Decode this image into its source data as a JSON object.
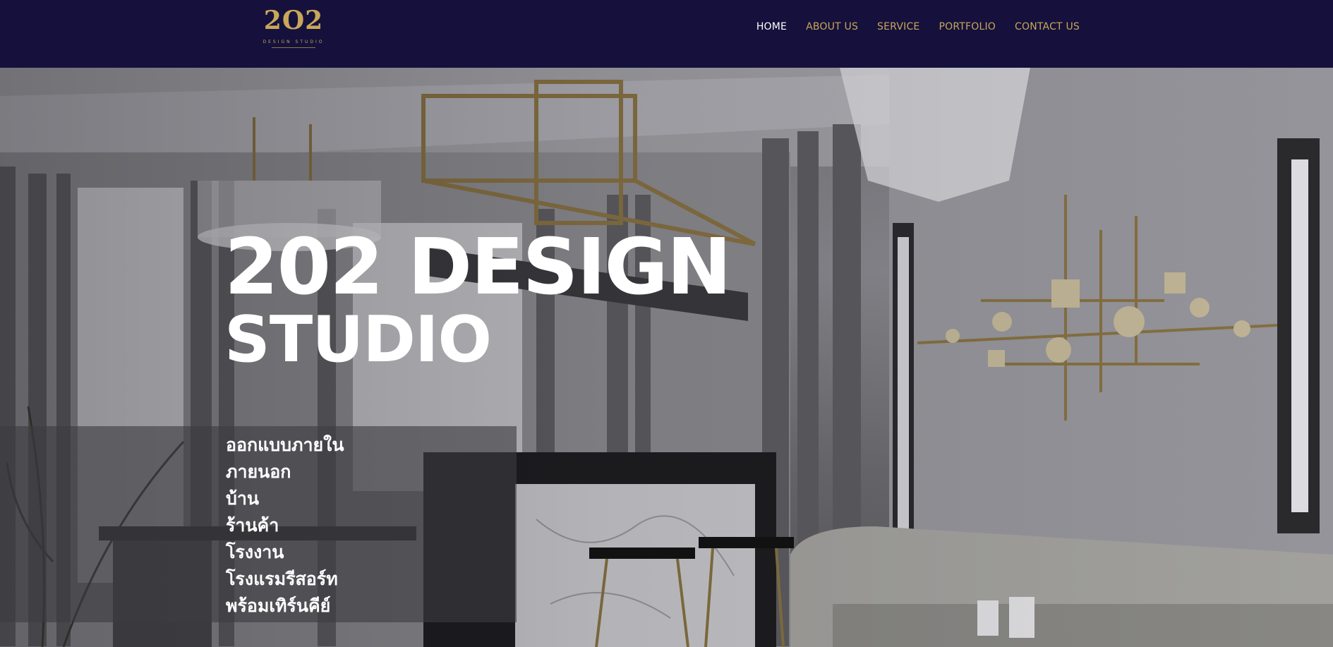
{
  "header": {
    "logo": {
      "mark": "2O2",
      "subtitle": "DESIGN STUDIO"
    },
    "nav": [
      {
        "label": "HOME",
        "active": true
      },
      {
        "label": "ABOUT US",
        "active": false
      },
      {
        "label": "SERVICE",
        "active": false
      },
      {
        "label": "PORTFOLIO",
        "active": false
      },
      {
        "label": "CONTACT US",
        "active": false
      }
    ]
  },
  "hero": {
    "title_line1": "202 DESIGN",
    "title_line2": "STUDIO",
    "services": [
      "ออกแบบภายใน",
      "ภายนอก",
      "บ้าน",
      "ร้านค้า",
      "โรงงาน",
      "โรงแรมรีสอร์ท",
      "พร้อมเทิร์นคีย์"
    ]
  },
  "colors": {
    "header_bg": "#15113c",
    "nav_gold": "#c8a75a",
    "nav_active": "#ffffff",
    "hero_text": "#ffffff"
  }
}
